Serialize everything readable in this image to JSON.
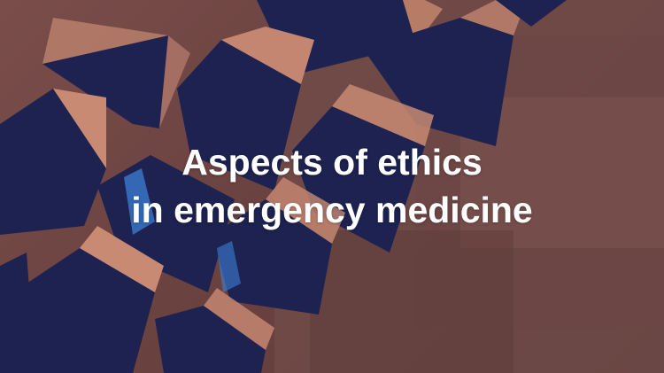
{
  "title": {
    "line1": "Aspects of ethics",
    "line2": "in emergency medicine"
  },
  "background": {
    "motif": "floating navy cubes on copper-brown background",
    "colors": {
      "backdrop": "#6e4644",
      "cube_face": "#1d2250",
      "cube_edge": "#c88a72",
      "accent_glow": "#3c7fd6"
    }
  }
}
